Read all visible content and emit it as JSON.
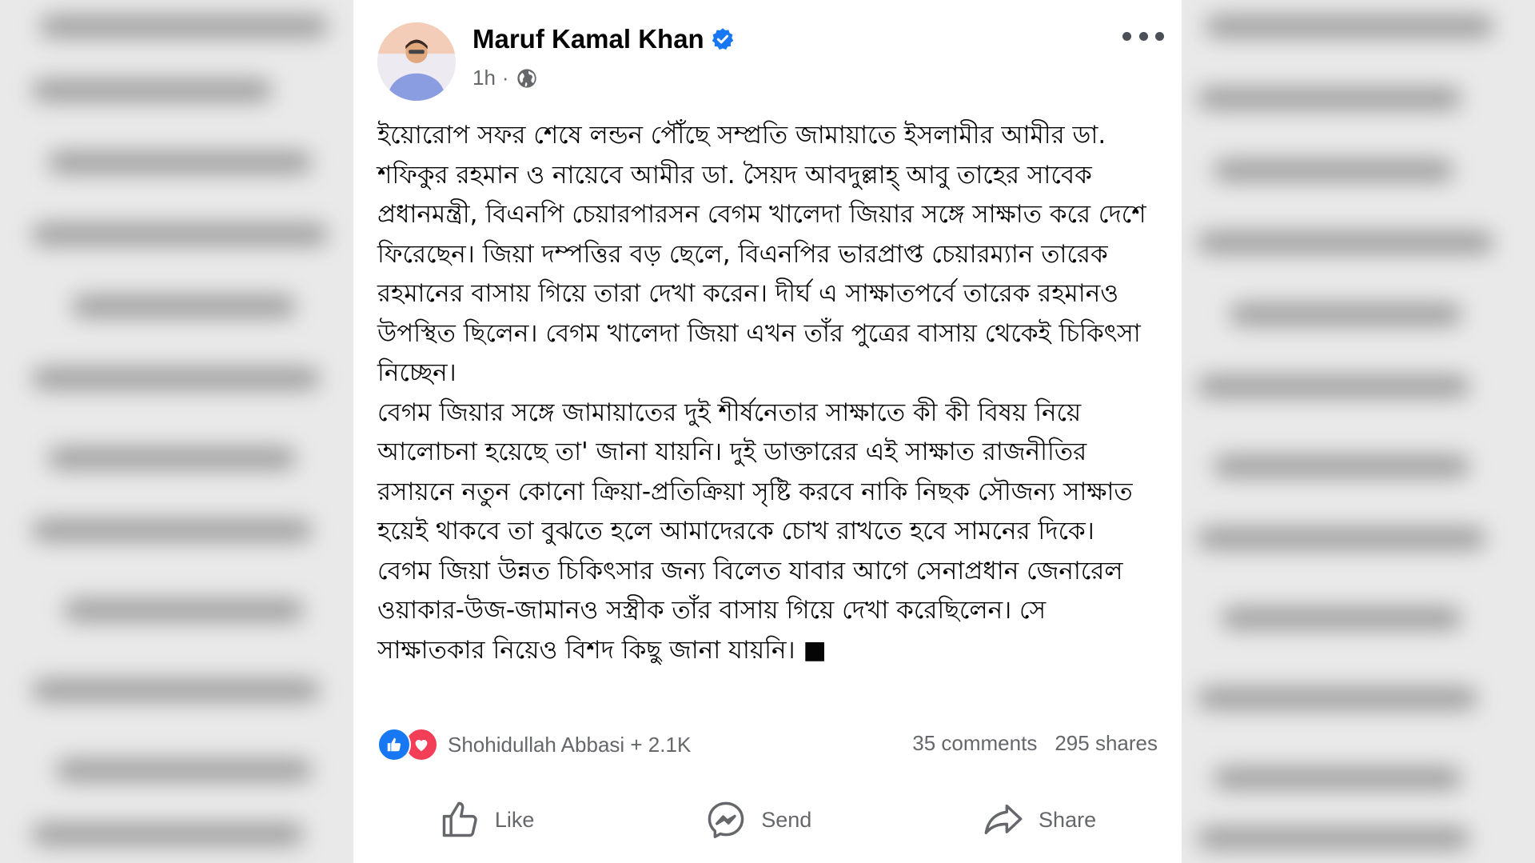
{
  "post": {
    "author": "Maruf Kamal Khan",
    "time": "1h",
    "separator": "·",
    "paragraphs": [
      "ইয়োরোপ সফর শেষে লন্ডন পৌঁছে সম্প্রতি জামায়াতে ইসলামীর আমীর ডা. শফিকুর রহমান ও নায়েবে আমীর ডা. সৈয়দ আবদুল্লাহ্ আবু তাহের সাবেক প্রধানমন্ত্রী, বিএনপি চেয়ারপারসন বেগম খালেদা জিয়ার সঙ্গে সাক্ষাত করে দেশে ফিরেছেন। জিয়া দম্পত্তির বড় ছেলে, বিএনপির ভারপ্রাপ্ত চেয়ারম্যান তারেক রহমানের বাসায় গিয়ে তারা দেখা করেন। দীর্ঘ এ সাক্ষাতপর্বে তারেক রহমানও উপস্থিত ছিলেন। বেগম খালেদা জিয়া এখন তাঁর পুত্রের বাসায় থেকেই চিকিৎসা নিচ্ছেন।",
      "বেগম জিয়ার সঙ্গে জামায়াতের দুই শীর্ষনেতার সাক্ষাতে কী কী বিষয় নিয়ে আলোচনা হয়েছে তা' জানা যায়নি। দুই ডাক্তারের এই সাক্ষাত রাজনীতির রসায়নে নতুন কোনো ক্রিয়া-প্রতিক্রিয়া সৃষ্টি করবে নাকি নিছক সৌজন্য সাক্ষাত হয়েই থাকবে তা বুঝতে হলে আমাদেরকে চোখ রাখতে হবে সামনের দিকে।",
      "বেগম জিয়া উন্নত চিকিৎসার জন্য বিলেত যাবার আগে সেনাপ্রধান জেনারেল ওয়াকার-উজ-জামানও সস্ত্রীক তাঁর বাসায় গিয়ে দেখা করেছিলেন। সে সাক্ষাতকার নিয়েও বিশদ কিছু জানা যায়নি। ■"
    ],
    "reactions_text": "Shohidullah Abbasi + 2.1K",
    "comments": "35 comments",
    "shares": "295 shares"
  },
  "actions": {
    "like": "Like",
    "send": "Send",
    "share": "Share"
  },
  "icons": [
    "avatar",
    "verified-icon",
    "globe-icon",
    "more-icon",
    "like-react-icon",
    "love-react-icon",
    "like-icon",
    "messenger-icon",
    "share-icon"
  ],
  "colors": {
    "accent": "#1877f2",
    "love": "#f33e58",
    "secondary_text": "#65676b",
    "primary_text": "#050505"
  }
}
